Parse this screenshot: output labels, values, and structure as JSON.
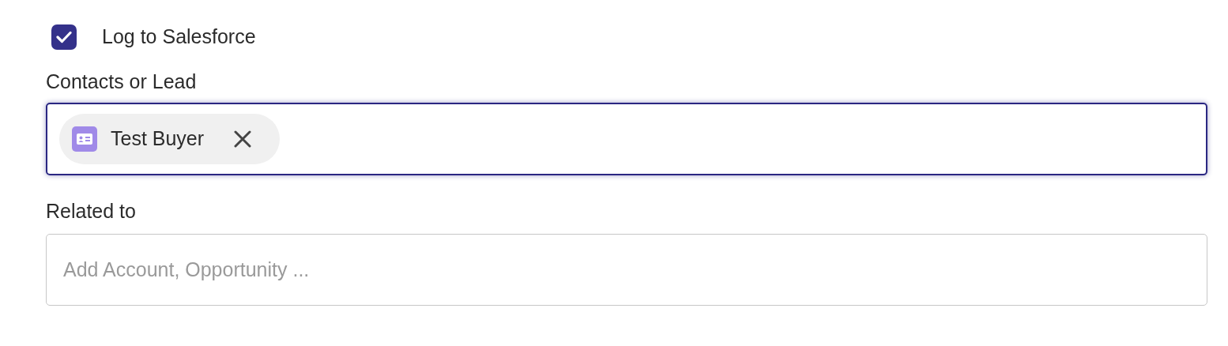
{
  "log_checkbox": {
    "label": "Log to Salesforce",
    "checked": true
  },
  "contacts_field": {
    "label": "Contacts or Lead",
    "focused": true,
    "chips": [
      {
        "label": "Test Buyer"
      }
    ]
  },
  "related_field": {
    "label": "Related to",
    "placeholder": "Add Account, Opportunity ..."
  }
}
